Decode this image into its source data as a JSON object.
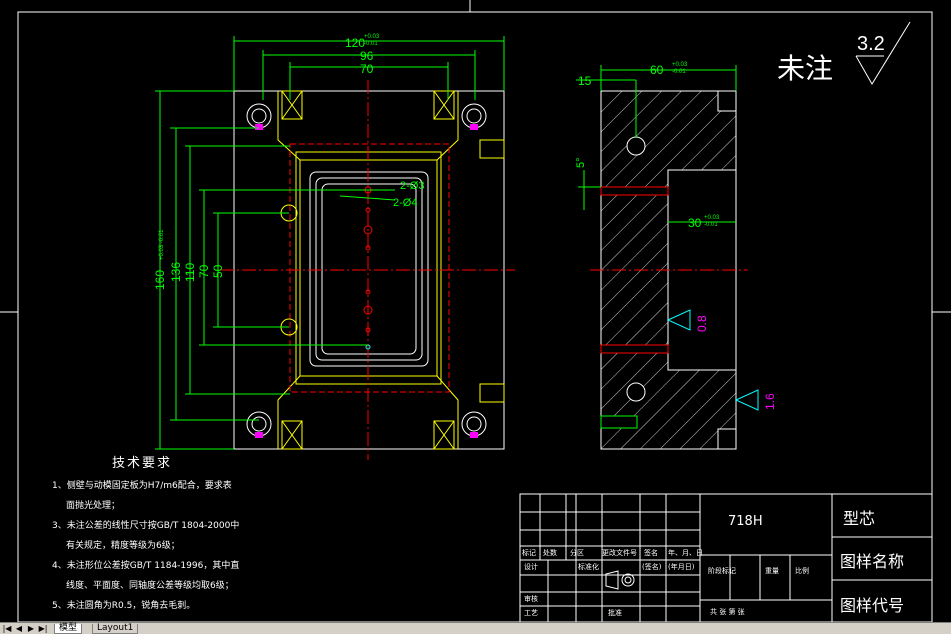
{
  "drawing": {
    "dims_top": {
      "d1": "120",
      "d1_tol": "+0.03\n-0.01",
      "d2": "96",
      "d3": "70"
    },
    "dims_left": [
      "160",
      "136",
      "110",
      "70",
      "50"
    ],
    "dim_left_tol": "+0.03 -0.01",
    "hole_labels": [
      "2-Ø3",
      "2-Ø4"
    ],
    "section_dims": {
      "top": "60",
      "left": "15",
      "angle": "5°",
      "depth": "30"
    },
    "roughness_a": "0.8",
    "roughness_b": "1.6",
    "note_unmarked": "未注",
    "note_roughness": "3.2"
  },
  "tech": {
    "title": "技术要求",
    "lines": [
      "1、侧壁与动模固定板为H7/m6配合，要求表",
      "面抛光处理；",
      "3、未注公差的线性尺寸按GB/T 1804-2000中",
      "有关规定，精度等级为6级；",
      "4、未注形位公差按GB/T 1184-1996，其中直",
      "线度、平面度、同轴度公差等级均取6级；",
      "5、未注圆角为R0.5，锐角去毛刺。"
    ]
  },
  "titleblock": {
    "material": "718H",
    "part_name": "型芯",
    "drawing_name_label": "图样名称",
    "drawing_code_label": "图样代号",
    "row_headers": [
      "标记",
      "处数",
      "分区",
      "更改文件号",
      "签名",
      "年、月、日"
    ],
    "roles": [
      "设计",
      "标准化",
      "审核",
      "工艺",
      "批准"
    ],
    "stage_headers": [
      "阶段标记",
      "重量",
      "比例"
    ],
    "sign_hint": "(签名)",
    "date_hint": "(年月日)",
    "sheet_row": "共  张  第  张"
  },
  "tabs": [
    "模型",
    "Layout1"
  ]
}
